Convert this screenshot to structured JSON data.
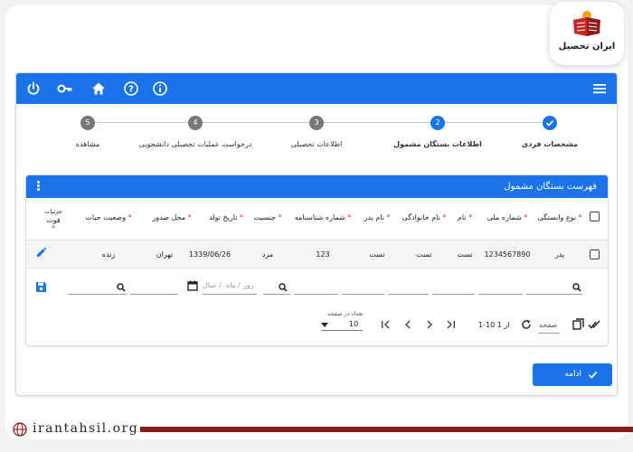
{
  "brand": {
    "name": "ایران تحصیل"
  },
  "stepper": {
    "steps": [
      {
        "number": "",
        "label": "مشخصات فردی"
      },
      {
        "number": "2",
        "label": "اطلاعات بستگان مشمول"
      },
      {
        "number": "3",
        "label": "اطلاعات تحصیلی"
      },
      {
        "number": "4",
        "label": "درخواست عملیات تحصیلی دانشجویی"
      },
      {
        "number": "5",
        "label": "مشاهده"
      }
    ]
  },
  "panel": {
    "title": "فهرست بستگان مشمول",
    "columns": [
      {
        "label": "نوع وابستگی"
      },
      {
        "label": "شماره ملی"
      },
      {
        "label": "نام"
      },
      {
        "label": "نام خانوادگی"
      },
      {
        "label": "نام پدر"
      },
      {
        "label": "شماره شناسنامه"
      },
      {
        "label": "جنسیت"
      },
      {
        "label": "تاریخ تولد"
      },
      {
        "label": "محل صدور"
      },
      {
        "label": "وضعیت حیات"
      },
      {
        "label": "جزئیات",
        "label2": "فوت"
      }
    ],
    "row": [
      "پدر",
      "1234567890",
      "تست",
      "تست",
      "تست",
      "123",
      "مرد",
      "1339/06/26",
      "تهران",
      "زنده"
    ],
    "date_filter": {
      "day": "روز",
      "month": "ماه",
      "year": "سال",
      "sep": "/"
    },
    "pager": {
      "page_label": "صفحه",
      "range": "1-10 از 1",
      "per_page_label": "تعداد در صفحه",
      "per_page": "10"
    }
  },
  "actions": {
    "continue_label": "ادامه"
  },
  "footer": {
    "site": "irantahsil.org"
  },
  "colors": {
    "primary": "#1a73e8",
    "required": "#d32f2f",
    "footer_bar": "#8b1a1a"
  }
}
